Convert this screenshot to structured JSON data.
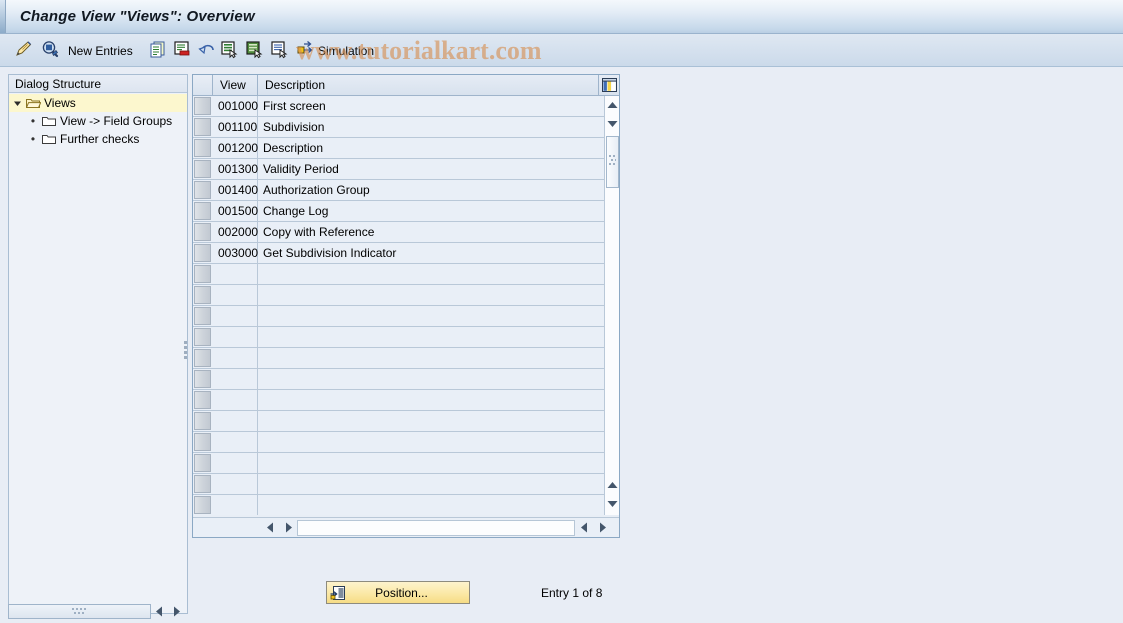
{
  "window": {
    "title": "Change View \"Views\": Overview"
  },
  "watermark": {
    "text": "www.tutorialkart.com"
  },
  "toolbar": {
    "items": [
      {
        "name": "display-change-icon",
        "label": "",
        "icon": "pencil-magnifier"
      },
      {
        "name": "check-entries-icon",
        "label": "",
        "icon": "magnifier-check"
      },
      {
        "name": "new-entries-button",
        "label": "New Entries",
        "icon": ""
      },
      {
        "name": "copy-as-icon",
        "label": "",
        "icon": "copy"
      },
      {
        "name": "delete-icon",
        "label": "",
        "icon": "delete"
      },
      {
        "name": "undo-icon",
        "label": "",
        "icon": "undo"
      },
      {
        "name": "select-all-icon",
        "label": "",
        "icon": "select-all"
      },
      {
        "name": "select-block-icon",
        "label": "",
        "icon": "select-block"
      },
      {
        "name": "deselect-all-icon",
        "label": "",
        "icon": "deselect-all"
      },
      {
        "name": "simulation-button",
        "label": "Simulation",
        "icon": "transport"
      }
    ],
    "new_entries_label": "New Entries",
    "simulation_label": "Simulation"
  },
  "sidebar": {
    "header": "Dialog Structure",
    "items": [
      {
        "label": "Views",
        "level": 0,
        "selected": true,
        "expanded": true,
        "icon": "folder-open-icon"
      },
      {
        "label": "View -> Field Groups",
        "level": 1,
        "selected": false,
        "expanded": false,
        "icon": "folder-icon"
      },
      {
        "label": "Further checks",
        "level": 1,
        "selected": false,
        "expanded": false,
        "icon": "folder-icon"
      }
    ]
  },
  "table": {
    "columns": [
      "View",
      "Description"
    ],
    "rows": [
      {
        "view": "001000",
        "description": "First screen"
      },
      {
        "view": "001100",
        "description": "Subdivision"
      },
      {
        "view": "001200",
        "description": "Description"
      },
      {
        "view": "001300",
        "description": "Validity Period"
      },
      {
        "view": "001400",
        "description": "Authorization Group"
      },
      {
        "view": "001500",
        "description": "Change Log"
      },
      {
        "view": "002000",
        "description": "Copy with Reference"
      },
      {
        "view": "003000",
        "description": "Get Subdivision Indicator"
      },
      {
        "view": "",
        "description": ""
      },
      {
        "view": "",
        "description": ""
      },
      {
        "view": "",
        "description": ""
      },
      {
        "view": "",
        "description": ""
      },
      {
        "view": "",
        "description": ""
      },
      {
        "view": "",
        "description": ""
      },
      {
        "view": "",
        "description": ""
      },
      {
        "view": "",
        "description": ""
      },
      {
        "view": "",
        "description": ""
      },
      {
        "view": "",
        "description": ""
      },
      {
        "view": "",
        "description": ""
      },
      {
        "view": "",
        "description": ""
      }
    ]
  },
  "footer": {
    "position_label": "Position...",
    "entry_status": "Entry 1 of 8"
  },
  "colors": {
    "title_accent": "#8cabc9",
    "selected_row": "#fcf7ce",
    "table_row": "#e9eff7",
    "button_yellow": "#fbe9a8",
    "watermark": "#d68e4f"
  }
}
